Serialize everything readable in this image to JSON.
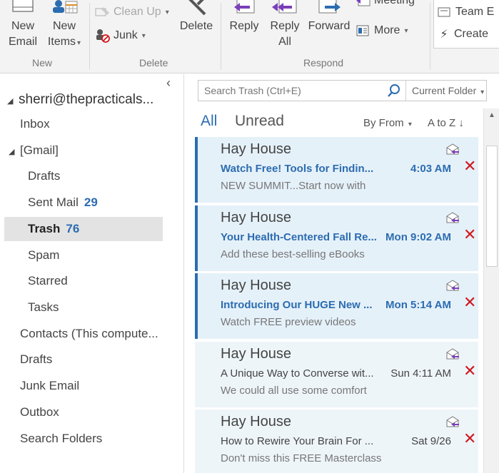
{
  "ribbon": {
    "new_email": [
      "New",
      "Email"
    ],
    "new_items": [
      "New",
      "Items"
    ],
    "group_new": "New",
    "clean_up": "Clean Up",
    "junk": "Junk",
    "delete": "Delete",
    "group_delete": "Delete",
    "reply": "Reply",
    "reply_all": [
      "Reply",
      "All"
    ],
    "forward": "Forward",
    "meeting": "Meeting",
    "more": "More",
    "group_respond": "Respond",
    "quick_team": "Team E",
    "quick_create": "Create"
  },
  "folders": {
    "account": "sherri@thepracticals...",
    "items": [
      {
        "label": "Inbox",
        "count": ""
      },
      {
        "label": "[Gmail]",
        "count": ""
      },
      {
        "label": "Drafts",
        "count": ""
      },
      {
        "label": "Sent Mail",
        "count": "29"
      },
      {
        "label": "Trash",
        "count": "76"
      },
      {
        "label": "Spam",
        "count": ""
      },
      {
        "label": "Starred",
        "count": ""
      },
      {
        "label": "Tasks",
        "count": ""
      },
      {
        "label": "Contacts (This compute...",
        "count": ""
      },
      {
        "label": "Drafts",
        "count": ""
      },
      {
        "label": "Junk Email",
        "count": ""
      },
      {
        "label": "Outbox",
        "count": ""
      },
      {
        "label": "Search Folders",
        "count": ""
      }
    ]
  },
  "search": {
    "placeholder": "Search Trash (Ctrl+E)",
    "scope": "Current Folder"
  },
  "filters": {
    "all": "All",
    "unread": "Unread",
    "by_from": "By From",
    "sort": "A to Z"
  },
  "messages": [
    {
      "sender": "Hay House",
      "subject": "Watch Free! Tools for Findin...",
      "time": "4:03 AM",
      "preview": "NEW SUMMIT...Start now with",
      "unread": true
    },
    {
      "sender": "Hay House",
      "subject": "Your Health-Centered Fall Re...",
      "time": "Mon 9:02 AM",
      "preview": "Add these best-selling eBooks",
      "unread": true
    },
    {
      "sender": "Hay House",
      "subject": "Introducing Our HUGE New ...",
      "time": "Mon 5:14 AM",
      "preview": "Watch FREE preview videos",
      "unread": true
    },
    {
      "sender": "Hay House",
      "subject": "A Unique Way to Converse wit...",
      "time": "Sun 4:11 AM",
      "preview": "We could all use some comfort",
      "unread": false
    },
    {
      "sender": "Hay House",
      "subject": "How to Rewire Your Brain For ...",
      "time": "Sat 9/26",
      "preview": "Don't miss this FREE Masterclass",
      "unread": false
    }
  ],
  "colors": {
    "accent": "#2c6cb0",
    "delete_x": "#d0181e",
    "unread_bg": "#e5f1f9",
    "reply_arrow": "#7b3fb8"
  }
}
